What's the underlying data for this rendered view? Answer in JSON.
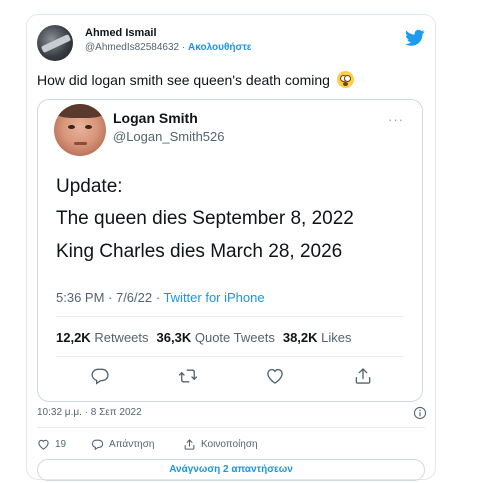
{
  "colors": {
    "twitter_blue": "#1d9bf0",
    "link_blue": "#1b95e0",
    "text": "#0f1419",
    "muted": "#536471"
  },
  "tweet": {
    "author_name": "Ahmed Ismail",
    "author_handle": "@AhmedIs82584632",
    "separator": "·",
    "follow_label": "Ακολουθήστε",
    "text": "How did logan smith see queen's death coming",
    "emoji": "flushed-face-emoji",
    "timestamp": "10:32 μ.μ. · 8 Σεπ 2022",
    "likes_count": "19",
    "reply_label": "Απάντηση",
    "share_label": "Κοινοποίηση",
    "read_replies_label": "Ανάγνωση 2 απαντήσεων"
  },
  "quoted": {
    "name": "Logan Smith",
    "handle": "@Logan_Smith526",
    "more_label": "···",
    "lines": [
      "Update:",
      "The queen dies September 8, 2022",
      "King Charles dies March 28, 2026"
    ],
    "time_date": "5:36 PM · 7/6/22 · ",
    "source": "Twitter for iPhone",
    "retweets_count": "12,2K",
    "retweets_label": "Retweets",
    "quote_count": "36,3K",
    "quote_label": "Quote Tweets",
    "likes_count": "38,2K",
    "likes_label": "Likes"
  },
  "icons": [
    "twitter-bird-icon",
    "reply-icon",
    "retweet-icon",
    "heart-icon",
    "share-icon",
    "info-icon"
  ]
}
